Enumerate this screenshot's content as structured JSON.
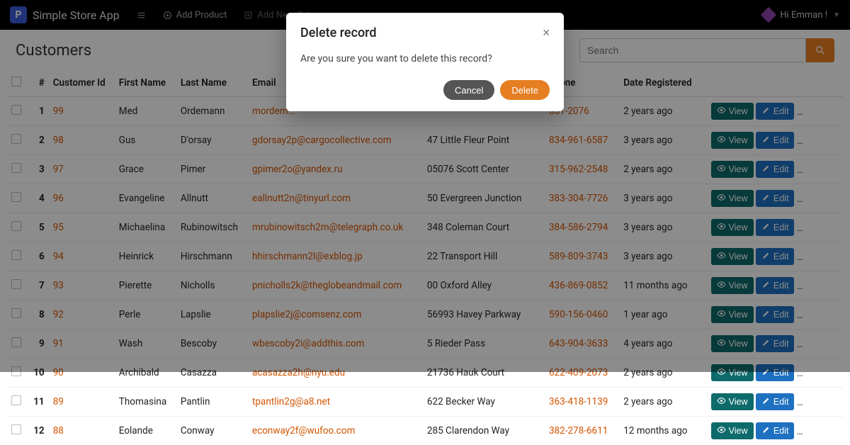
{
  "nav": {
    "app_name": "Simple Store App",
    "add_product": "Add Product",
    "add_sale": "Add New Sale",
    "user_greeting": "Hi Emman !"
  },
  "page": {
    "title": "Customers",
    "search_placeholder": "Search"
  },
  "columns": {
    "num": "#",
    "id": "Customer Id",
    "first": "First Name",
    "last": "Last Name",
    "email": "Email",
    "phone": "phone",
    "date": "Date Registered"
  },
  "actions": {
    "view": "View",
    "edit": "Edit",
    "delete": "Delete"
  },
  "rows": [
    {
      "n": "1",
      "id": "99",
      "fn": "Med",
      "ln": "Ordemann",
      "email": "mordem…",
      "addr": "",
      "phone": "851-2076",
      "date": "2 years ago"
    },
    {
      "n": "2",
      "id": "98",
      "fn": "Gus",
      "ln": "D'orsay",
      "email": "gdorsay2p@cargocollective.com",
      "addr": "47 Little Fleur Point",
      "phone": "834-961-6587",
      "date": "3 years ago"
    },
    {
      "n": "3",
      "id": "97",
      "fn": "Grace",
      "ln": "Pimer",
      "email": "gpimer2o@yandex.ru",
      "addr": "05076 Scott Center",
      "phone": "315-962-2548",
      "date": "2 years ago"
    },
    {
      "n": "4",
      "id": "96",
      "fn": "Evangeline",
      "ln": "Allnutt",
      "email": "eallnutt2n@tinyurl.com",
      "addr": "50 Evergreen Junction",
      "phone": "383-304-7726",
      "date": "3 years ago"
    },
    {
      "n": "5",
      "id": "95",
      "fn": "Michaelina",
      "ln": "Rubinowitsch",
      "email": "mrubinowitsch2m@telegraph.co.uk",
      "addr": "348 Coleman Court",
      "phone": "384-586-2794",
      "date": "3 years ago"
    },
    {
      "n": "6",
      "id": "94",
      "fn": "Heinrick",
      "ln": "Hirschmann",
      "email": "hhirschmann2l@exblog.jp",
      "addr": "22 Transport Hill",
      "phone": "589-809-3743",
      "date": "3 years ago"
    },
    {
      "n": "7",
      "id": "93",
      "fn": "Pierette",
      "ln": "Nicholls",
      "email": "pnicholls2k@theglobeandmail.com",
      "addr": "00 Oxford Alley",
      "phone": "436-869-0852",
      "date": "11 months ago"
    },
    {
      "n": "8",
      "id": "92",
      "fn": "Perle",
      "ln": "Lapslie",
      "email": "plapslie2j@comsenz.com",
      "addr": "56993 Havey Parkway",
      "phone": "590-156-0460",
      "date": "1 year ago"
    },
    {
      "n": "9",
      "id": "91",
      "fn": "Wash",
      "ln": "Bescoby",
      "email": "wbescoby2i@addthis.com",
      "addr": "5 Rieder Pass",
      "phone": "643-904-3633",
      "date": "4 years ago"
    },
    {
      "n": "10",
      "id": "90",
      "fn": "Archibald",
      "ln": "Casazza",
      "email": "acasazza2h@nyu.edu",
      "addr": "21736 Hauk Court",
      "phone": "622-409-2073",
      "date": "2 years ago"
    },
    {
      "n": "11",
      "id": "89",
      "fn": "Thomasina",
      "ln": "Pantlin",
      "email": "tpantlin2g@a8.net",
      "addr": "622 Becker Way",
      "phone": "363-418-1139",
      "date": "2 years ago"
    },
    {
      "n": "12",
      "id": "88",
      "fn": "Eolande",
      "ln": "Conway",
      "email": "econway2f@wufoo.com",
      "addr": "285 Clarendon Way",
      "phone": "382-278-6611",
      "date": "12 months ago"
    }
  ],
  "modal": {
    "title": "Delete record",
    "body": "Are you sure you want to delete this record?",
    "cancel": "Cancel",
    "confirm": "Delete"
  }
}
